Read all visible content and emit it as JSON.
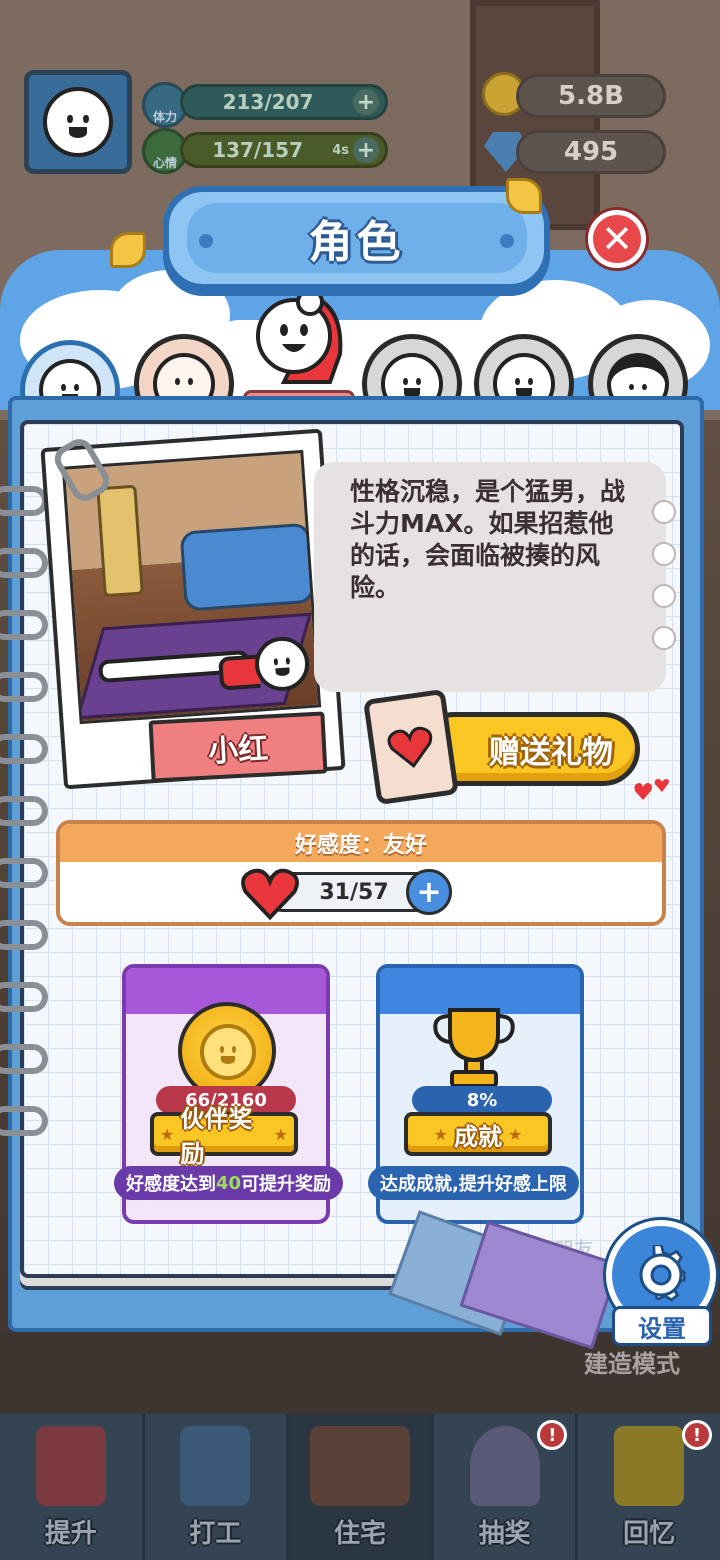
{
  "hud": {
    "stamina_label": "体力",
    "stamina_value": "213/207",
    "mood_label": "心情",
    "mood_value": "137/157",
    "mood_timer": "4s",
    "plus_symbol": "+",
    "gold_value": "5.8B",
    "gem_value": "495"
  },
  "panel": {
    "title": "角色",
    "close_symbol": "✕"
  },
  "character": {
    "name": "小红",
    "description": "性格沉稳，是个猛男，战斗力MAX。如果招惹他的话，会面临被揍的风险。"
  },
  "gift": {
    "label": "赠送礼物"
  },
  "favor": {
    "header": "好感度：友好",
    "value": "31/57",
    "plus_symbol": "+"
  },
  "partner_reward": {
    "progress": "66/2160",
    "button_label": "伙伴奖励",
    "hint_prefix": "好感度达到",
    "hint_highlight": "40",
    "hint_suffix": "可提升奖励"
  },
  "achievement": {
    "progress": "8%",
    "button_label": "成就",
    "hint": "达成成就,提升好感上限"
  },
  "settings": {
    "label": "设置"
  },
  "build_mode_label": "建造模式",
  "watermark": "小蓝和他的朋友",
  "bottom_nav": {
    "items": [
      {
        "label": "提升",
        "badge": ""
      },
      {
        "label": "打工",
        "badge": ""
      },
      {
        "label": "住宅",
        "badge": ""
      },
      {
        "label": "抽奖",
        "badge": "!"
      },
      {
        "label": "回忆",
        "badge": "!"
      }
    ]
  },
  "colors": {
    "accent_blue": "#5ea4e6",
    "gift_yellow": "#f9c623",
    "favor_orange": "#f4a85c",
    "purple_card": "#a658d8",
    "blue_card": "#3f86e0",
    "close_red": "#e8474c"
  }
}
